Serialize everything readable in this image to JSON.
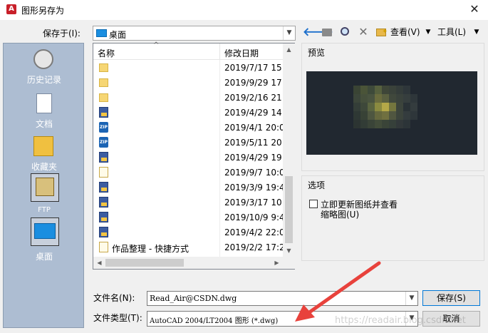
{
  "window": {
    "title": "图形另存为",
    "close_glyph": "✕"
  },
  "toolbar": {
    "save_in_label": "保存于(I):",
    "save_in_value": "桌面",
    "views_label": "查看(V)",
    "tools_label": "工具(L)"
  },
  "places": [
    {
      "label": "历史记录"
    },
    {
      "label": "文档"
    },
    {
      "label": "收藏夹"
    },
    {
      "label": "FTP"
    },
    {
      "label": "桌面"
    }
  ],
  "filelist": {
    "columns": {
      "name": "名称",
      "date": "修改日期"
    },
    "rows": [
      {
        "icon": "folder",
        "name": "",
        "date": "2019/7/17 15:"
      },
      {
        "icon": "folder",
        "name": "",
        "date": "2019/9/29 17:"
      },
      {
        "icon": "folder",
        "name": "",
        "date": "2019/2/16 21:"
      },
      {
        "icon": "dwg",
        "name": "",
        "date": "2019/4/29 14:"
      },
      {
        "icon": "zip",
        "name": "",
        "date": "2019/4/1 20:0"
      },
      {
        "icon": "zip",
        "name": "",
        "date": "2019/5/11 20:"
      },
      {
        "icon": "dwg",
        "name": "",
        "date": "2019/4/29 19:"
      },
      {
        "icon": "shortcut",
        "name": "",
        "date": "2019/9/7 10:0"
      },
      {
        "icon": "dwg",
        "name": "",
        "date": "2019/3/9 19:4"
      },
      {
        "icon": "dwg",
        "name": "",
        "date": "2019/3/17 10:"
      },
      {
        "icon": "dwg",
        "name": "",
        "date": "2019/10/9 9:4"
      },
      {
        "icon": "dwg",
        "name": "",
        "date": "2019/4/2 22:0"
      },
      {
        "icon": "shortcut",
        "name": "作品整理 - 快捷方式",
        "date": "2019/2/2 17:2"
      }
    ]
  },
  "preview": {
    "label": "预览"
  },
  "options": {
    "label": "选项",
    "checkbox_line1": "立即更新图纸并查看",
    "checkbox_line2": "缩略图(U)",
    "checked": false
  },
  "form": {
    "filename_label": "文件名(N):",
    "filename_value": "Read_Air@CSDN.dwg",
    "filetype_label": "文件类型(T):",
    "filetype_value": "AutoCAD 2004/LT2004 图形 (*.dwg)",
    "save_button": "保存(S)",
    "cancel_button": "取消"
  },
  "overlay": {
    "arrow_color": "#e8423c",
    "watermark": "https://readair.blog.csdn.net"
  },
  "icons": [
    "autocad-app-icon",
    "close-icon",
    "back-arrow-icon",
    "up-folder-icon",
    "search-web-icon",
    "delete-icon",
    "new-folder-icon",
    "history-icon",
    "documents-icon",
    "favorites-icon",
    "ftp-icon",
    "desktop-icon",
    "folder-icon",
    "dwg-file-icon",
    "zip-file-icon",
    "shortcut-icon"
  ]
}
